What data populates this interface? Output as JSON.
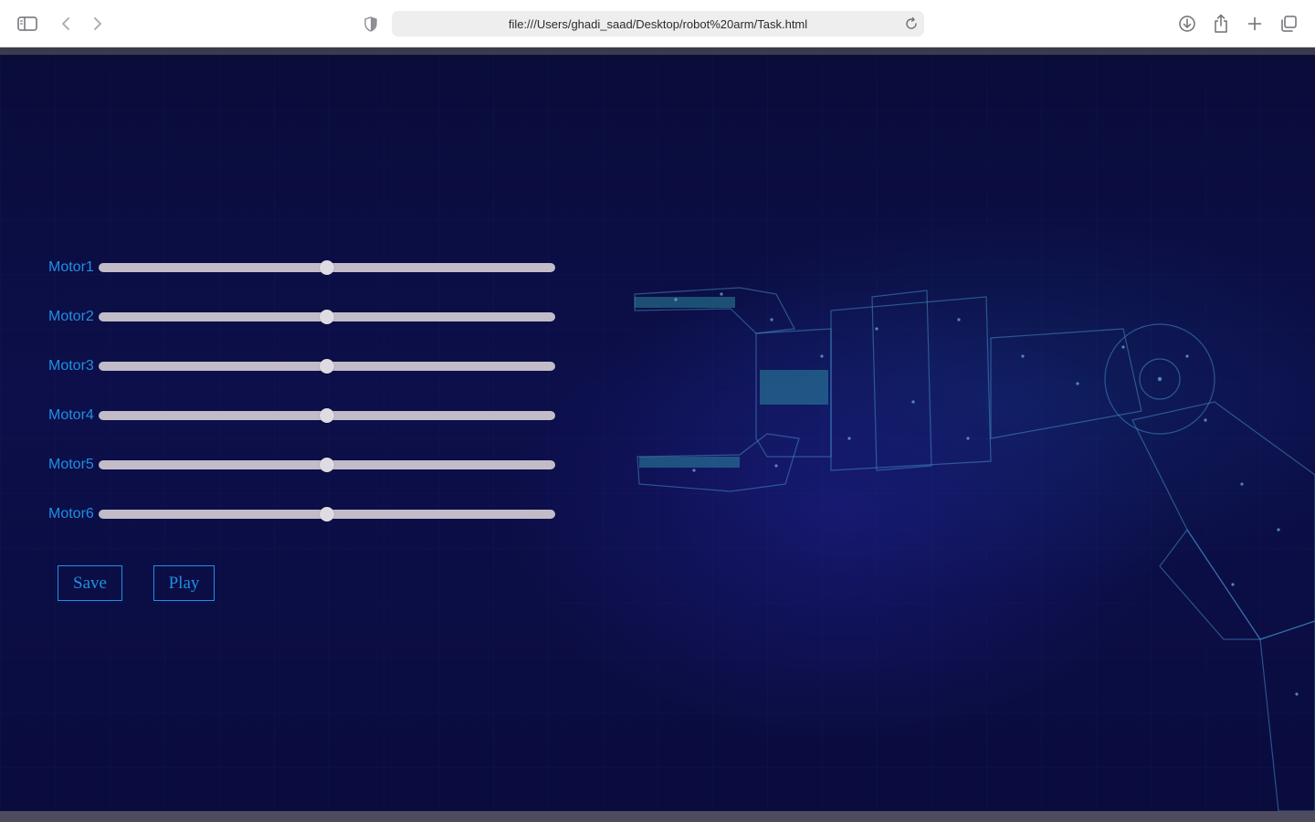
{
  "browser": {
    "url": "file:///Users/ghadi_saad/Desktop/robot%20arm/Task.html",
    "icons": [
      "sidebar-icon",
      "back-icon",
      "forward-icon",
      "shield-icon",
      "reload-icon",
      "download-icon",
      "share-icon",
      "new-tab-icon",
      "tab-overview-icon"
    ]
  },
  "controls": {
    "motors": [
      {
        "label": "Motor1",
        "value": 0.5
      },
      {
        "label": "Motor2",
        "value": 0.5
      },
      {
        "label": "Motor3",
        "value": 0.5
      },
      {
        "label": "Motor4",
        "value": 0.5
      },
      {
        "label": "Motor5",
        "value": 0.5
      },
      {
        "label": "Motor6",
        "value": 0.5
      }
    ],
    "save_label": "Save",
    "play_label": "Play"
  },
  "colors": {
    "accent": "#1f8fe6",
    "background": "#0b0d42",
    "track": "#c2bcc8"
  }
}
